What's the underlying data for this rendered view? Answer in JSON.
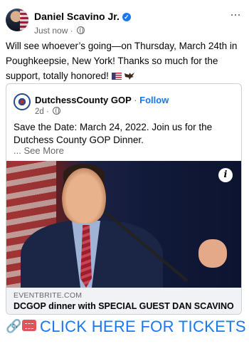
{
  "post": {
    "author": "Daniel Scavino Jr.",
    "verified_icon": "verified-badge-icon",
    "time": "Just now",
    "dot": "·",
    "text": "Will see whoever’s going—on Thursday, March 24th in Poughkeepsie, New York! Thanks so much for the support, totally honored!",
    "more_icon": "···"
  },
  "shared": {
    "page_name": "DutchessCounty GOP",
    "separator": "·",
    "follow_label": "Follow",
    "time": "2d",
    "dot": "·",
    "text": "Save the Date: March 24, 2022. Join us for the Dutchess County GOP Dinner.",
    "see_more": "... See More",
    "info_icon": "i",
    "link_domain": "EVENTBRITE.COM",
    "link_title": "DCGOP dinner with SPECIAL GUEST DAN SCAVINO"
  },
  "cta": {
    "link_icon": "🔗",
    "label": "CLICK HERE FOR TICKETS"
  },
  "colors": {
    "accent": "#1877f2",
    "muted": "#65676b",
    "link_bar": "#f0f2f5"
  }
}
